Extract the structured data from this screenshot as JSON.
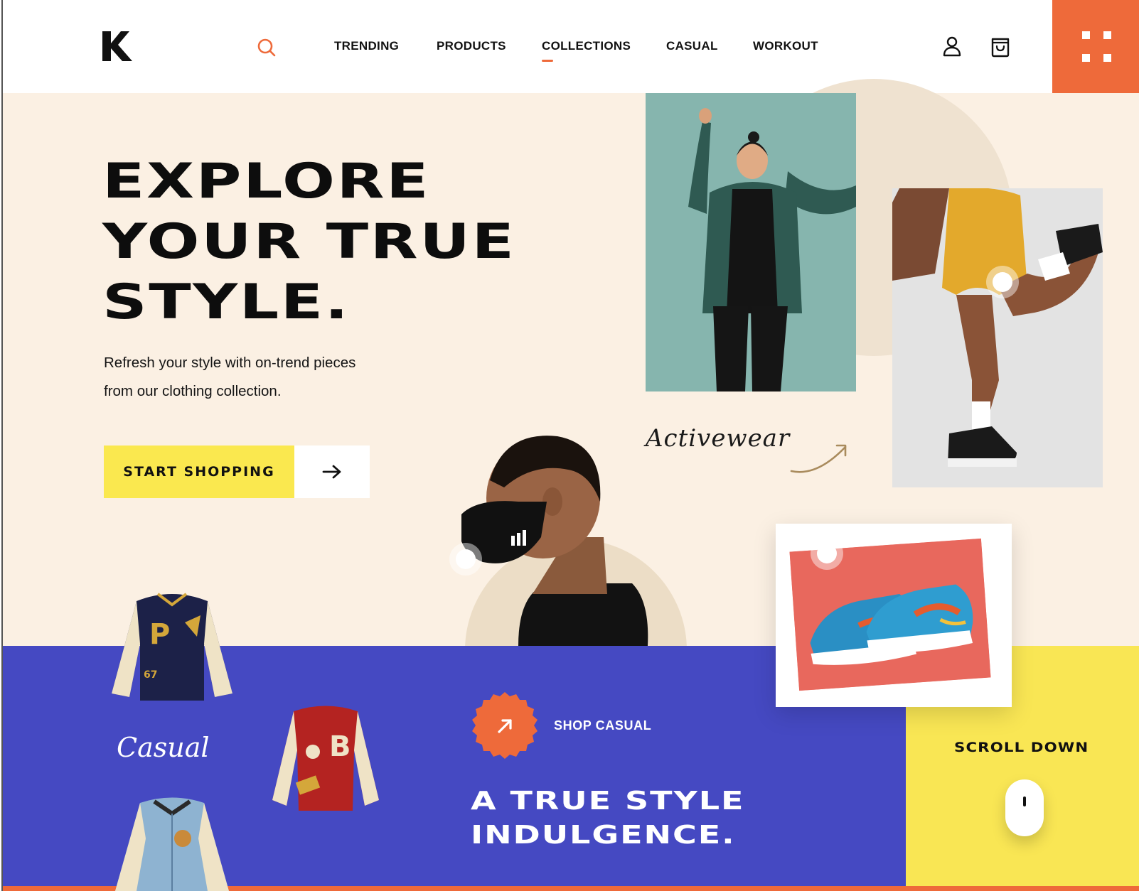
{
  "brand": {
    "logo_letter": "K",
    "accent": "#ee6a3a",
    "blue": "#4549c2",
    "yellow": "#f9e654",
    "cream": "#fbf0e3"
  },
  "header": {
    "search_icon": "search-icon",
    "nav": [
      {
        "label": "TRENDING"
      },
      {
        "label": "PRODUCTS"
      },
      {
        "label": "COLLECTIONS",
        "active": true
      },
      {
        "label": "CASUAL"
      },
      {
        "label": "WORKOUT"
      }
    ],
    "user_icon": "user-icon",
    "cart_icon": "shopping-bag-icon",
    "menu_icon": "grid-menu-icon"
  },
  "hero": {
    "title_lines": [
      "EXPLORE",
      "YOUR TRUE",
      "STYLE."
    ],
    "subtitle_line1": "Refresh your style with on-trend pieces",
    "subtitle_line2": "from our clothing collection.",
    "cta_label": "START SHOPPING",
    "cta_icon": "arrow-right-icon",
    "activewear_label": "Activewear"
  },
  "casual_section": {
    "script_label": "Casual",
    "badge_icon": "arrow-up-right-icon",
    "shop_label": "SHOP CASUAL",
    "title_lines": [
      "A TRUE STYLE",
      "INDULGENCE."
    ]
  },
  "scroll": {
    "label": "SCROLL DOWN",
    "icon": "mouse-icon"
  }
}
